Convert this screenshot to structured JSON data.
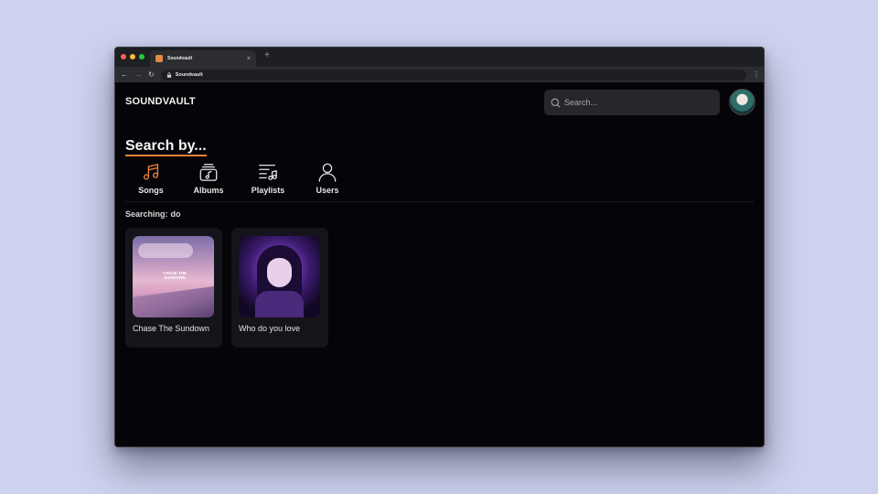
{
  "browser": {
    "tab_title": "Soundvault",
    "tab_close": "×",
    "new_tab": "+",
    "url": "Soundvault",
    "traffic_colors": [
      "#ff5f57",
      "#febc2e",
      "#28c840"
    ]
  },
  "header": {
    "logo": "SOUNDVAULT",
    "search_placeholder": "Search..."
  },
  "search_by": {
    "heading": "Search by...",
    "accent_color": "#e8803a",
    "categories": [
      {
        "label": "Songs",
        "icon": "music-note-icon",
        "active": true
      },
      {
        "label": "Albums",
        "icon": "album-icon",
        "active": false
      },
      {
        "label": "Playlists",
        "icon": "playlist-icon",
        "active": false
      },
      {
        "label": "Users",
        "icon": "user-icon",
        "active": false
      }
    ]
  },
  "results": {
    "label": "Searching:",
    "query": "do",
    "items": [
      {
        "title": "Chase The Sundown",
        "cover_text": "CHASE THE SUNDOWN"
      },
      {
        "title": "Who do you love"
      }
    ]
  }
}
